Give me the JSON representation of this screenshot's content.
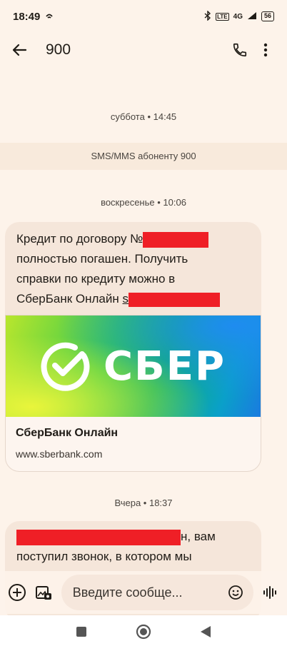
{
  "status": {
    "time": "18:49",
    "network": "4G",
    "lte": "LTE",
    "battery": "56"
  },
  "header": {
    "title": "900"
  },
  "thread": {
    "date1": "суббота • 14:45",
    "sms_banner": "SMS/MMS абоненту 900",
    "date2": "воскресенье • 10:06",
    "msg1": {
      "line1": "Кредит по договору №",
      "line2": "полностью погашен. Получить",
      "line3": "справки по кредиту можно в",
      "line4": "СберБанк Онлайн",
      "link_start": "s"
    },
    "preview": {
      "brand": "СБЕР",
      "title": "СберБанк Онлайн",
      "url": "www.sberbank.com"
    },
    "date3": "Вчера • 18:37",
    "msg2": {
      "line1_tail": "н, вам",
      "line2": "поступил звонок, в котором мы"
    }
  },
  "composer": {
    "placeholder": "Введите сообще..."
  },
  "colors": {
    "redaction": "#ef1f26",
    "sber_green": "#21a038"
  }
}
